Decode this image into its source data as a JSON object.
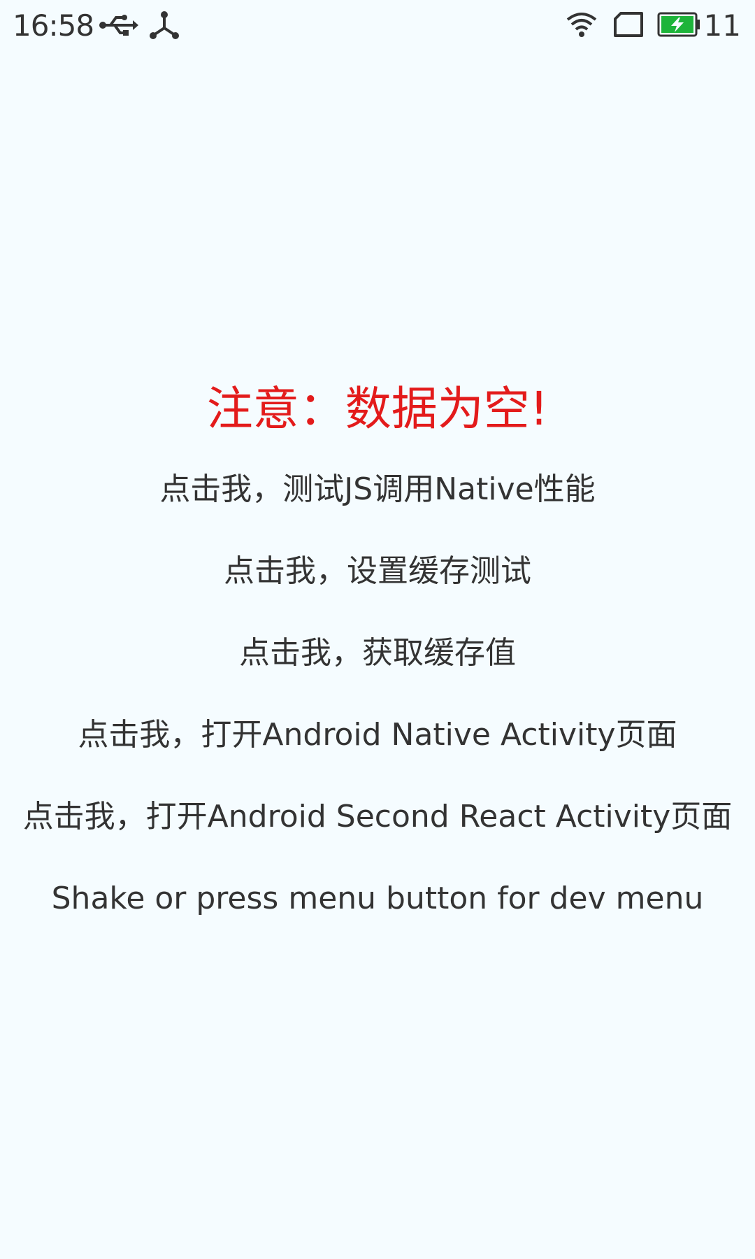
{
  "status_bar": {
    "time": "16:58",
    "battery_level": "11",
    "icons": [
      "usb-icon",
      "share-icon",
      "wifi-icon",
      "sim-card-icon",
      "battery-charging-icon"
    ],
    "battery_color": "#1DB43A"
  },
  "screen": {
    "background_color": "#F5FCFF",
    "warning_text": "注意：数据为空!",
    "warning_color": "#E31B1B",
    "actions": [
      "点击我，测试JS调用Native性能",
      "点击我，设置缓存测试",
      "点击我，获取缓存值",
      "点击我，打开Android Native Activity页面",
      "点击我，打开Android Second React Activity页面"
    ],
    "dev_menu_hint": "Shake or press menu button for dev menu"
  }
}
